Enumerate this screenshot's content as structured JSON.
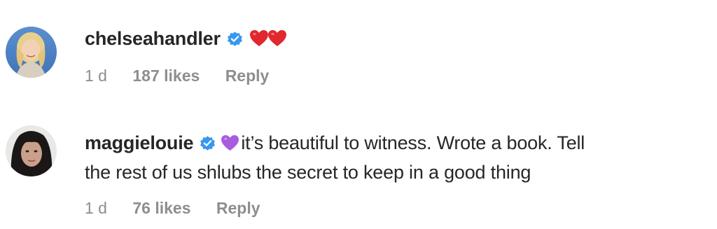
{
  "comments": [
    {
      "username": "chelseahandler",
      "verified": true,
      "emoji": "heart-heart",
      "text": "",
      "time": "1 d",
      "likes": "187 likes",
      "reply": "Reply"
    },
    {
      "username": "maggielouie",
      "verified": true,
      "emoji": "purple-heart",
      "text_line1": "it’s beautiful to witness. Wrote a book. Tell",
      "text_line2": "the rest of us shlubs the secret to keep in a good thing",
      "time": "1 d",
      "likes": "76 likes",
      "reply": "Reply"
    }
  ],
  "colors": {
    "text": "#262626",
    "secondary": "#8e8e8e",
    "verified": "#3897f0",
    "red_heart": "#e0282e",
    "purple_heart": "#a85de0"
  }
}
